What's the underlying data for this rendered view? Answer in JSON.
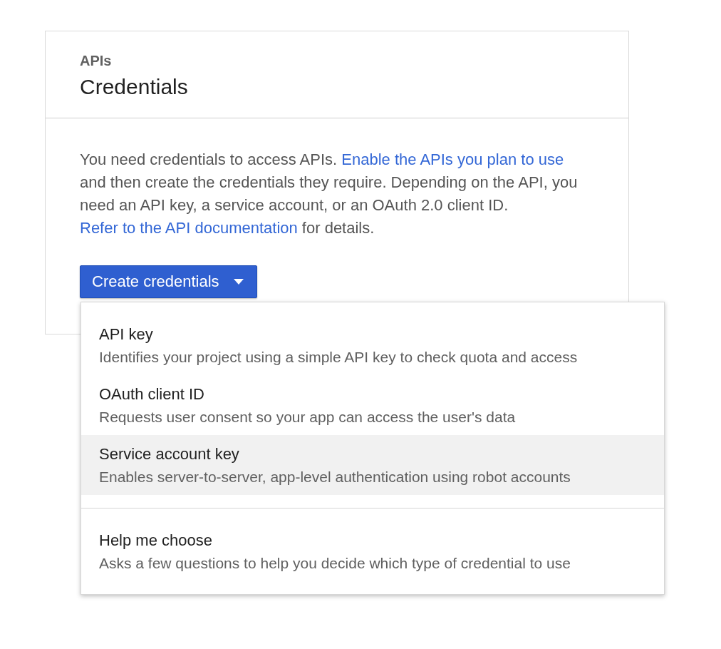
{
  "card": {
    "section": "APIs",
    "title": "Credentials",
    "intro": [
      {
        "kind": "text",
        "text": "You need credentials to access APIs. "
      },
      {
        "kind": "link",
        "text": "Enable the APIs you plan to use"
      },
      {
        "kind": "text",
        "text": " and then create the credentials they require. Depending on the API, you need an API key, a service account, or an OAuth 2.0 client ID. "
      },
      {
        "kind": "link",
        "text": "Refer to the API documentation"
      },
      {
        "kind": "text",
        "text": " for details."
      }
    ],
    "button": {
      "label": "Create credentials",
      "expanded": true
    }
  },
  "menu": {
    "groups": [
      {
        "items": [
          {
            "title": "API key",
            "description": "Identifies your project using a simple API key to check quota and access",
            "highlighted": false
          },
          {
            "title": "OAuth client ID",
            "description": "Requests user consent so your app can access the user's data",
            "highlighted": false
          },
          {
            "title": "Service account key",
            "description": "Enables server-to-server, app-level authentication using robot accounts",
            "highlighted": true
          }
        ]
      },
      {
        "items": [
          {
            "title": "Help me choose",
            "description": "Asks a few questions to help you decide which type of credential to use",
            "highlighted": false
          }
        ]
      }
    ]
  }
}
